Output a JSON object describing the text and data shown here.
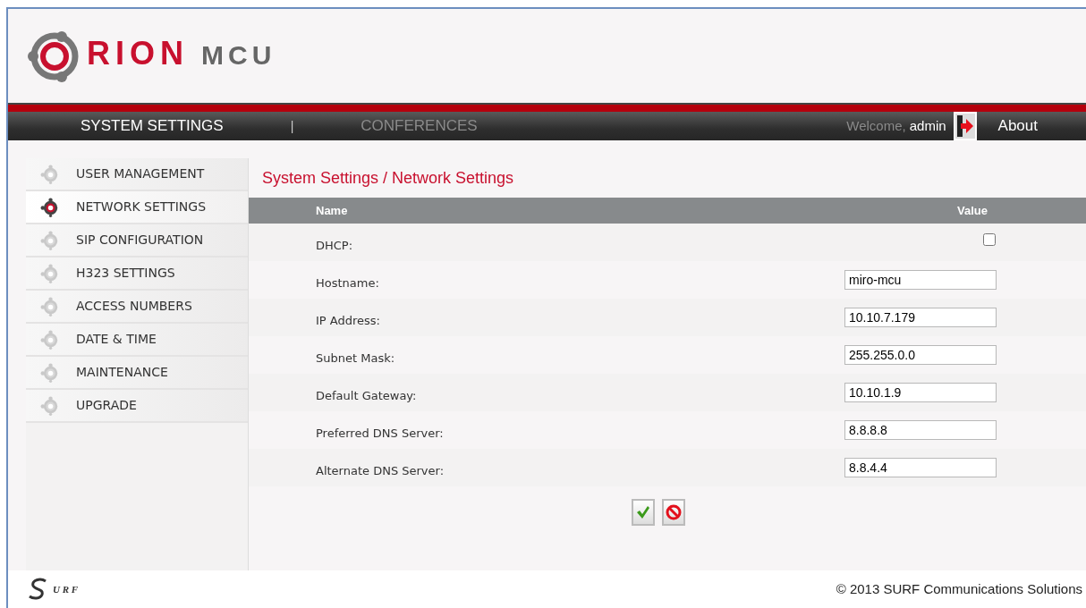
{
  "logo": {
    "name": "RION",
    "product": "MCU"
  },
  "nav": {
    "tabs": [
      {
        "label": "SYSTEM SETTINGS",
        "selected": true
      },
      {
        "label": "CONFERENCES",
        "selected": false
      }
    ],
    "separator": "|",
    "welcome": "Welcome,",
    "user": "admin",
    "about": "About"
  },
  "sidebar": {
    "items": [
      {
        "label": "USER MANAGEMENT",
        "selected": false
      },
      {
        "label": "NETWORK SETTINGS",
        "selected": true
      },
      {
        "label": "SIP CONFIGURATION",
        "selected": false
      },
      {
        "label": "H323 SETTINGS",
        "selected": false
      },
      {
        "label": "ACCESS NUMBERS",
        "selected": false
      },
      {
        "label": "DATE & TIME",
        "selected": false
      },
      {
        "label": "MAINTENANCE",
        "selected": false
      },
      {
        "label": "UPGRADE",
        "selected": false
      }
    ]
  },
  "breadcrumb": "System Settings / Network Settings",
  "table": {
    "columns": [
      "Name",
      "Value"
    ],
    "rows": [
      {
        "label": "DHCP:",
        "kind": "checkbox",
        "checked": false
      },
      {
        "label": "Hostname:",
        "kind": "text",
        "value": "miro-mcu"
      },
      {
        "label": "IP Address:",
        "kind": "text",
        "value": "10.10.7.179"
      },
      {
        "label": "Subnet Mask:",
        "kind": "text",
        "value": "255.255.0.0"
      },
      {
        "label": "Default Gateway:",
        "kind": "text",
        "value": "10.10.1.9"
      },
      {
        "label": "Preferred DNS Server:",
        "kind": "text",
        "value": "8.8.8.8"
      },
      {
        "label": "Alternate DNS Server:",
        "kind": "text",
        "value": "8.8.4.4"
      }
    ]
  },
  "footer": {
    "logo": "U R F",
    "copyright": "© 2013 SURF Communications Solutions"
  }
}
